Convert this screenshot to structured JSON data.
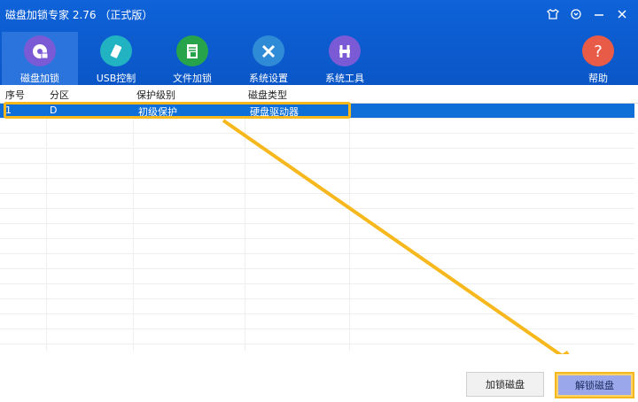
{
  "app": {
    "title": "磁盘加锁专家 2.76 （正式版）"
  },
  "nav": [
    {
      "label": "磁盘加锁",
      "icon": "disk-lock-icon",
      "color": "#7b5ad6"
    },
    {
      "label": "USB控制",
      "icon": "usb-icon",
      "color": "#22b3c2"
    },
    {
      "label": "文件加锁",
      "icon": "file-lock-icon",
      "color": "#27a34b"
    },
    {
      "label": "系统设置",
      "icon": "tools-icon",
      "color": "#2f8bd6"
    },
    {
      "label": "系统工具",
      "icon": "toolbox-icon",
      "color": "#7b5ad6"
    },
    {
      "label": "帮助",
      "icon": "help-icon",
      "color": "#e85b47"
    }
  ],
  "table": {
    "headers": [
      "序号",
      "分区",
      "保护级别",
      "磁盘类型"
    ],
    "rows": [
      [
        "1",
        "D",
        "初级保护",
        "硬盘驱动器"
      ]
    ]
  },
  "footer": {
    "lock_label": "加锁磁盘",
    "unlock_label": "解锁磁盘"
  },
  "colors": {
    "header": "#0f62d8",
    "selected_row": "#0f6fd8",
    "highlight": "#f6b81c"
  }
}
